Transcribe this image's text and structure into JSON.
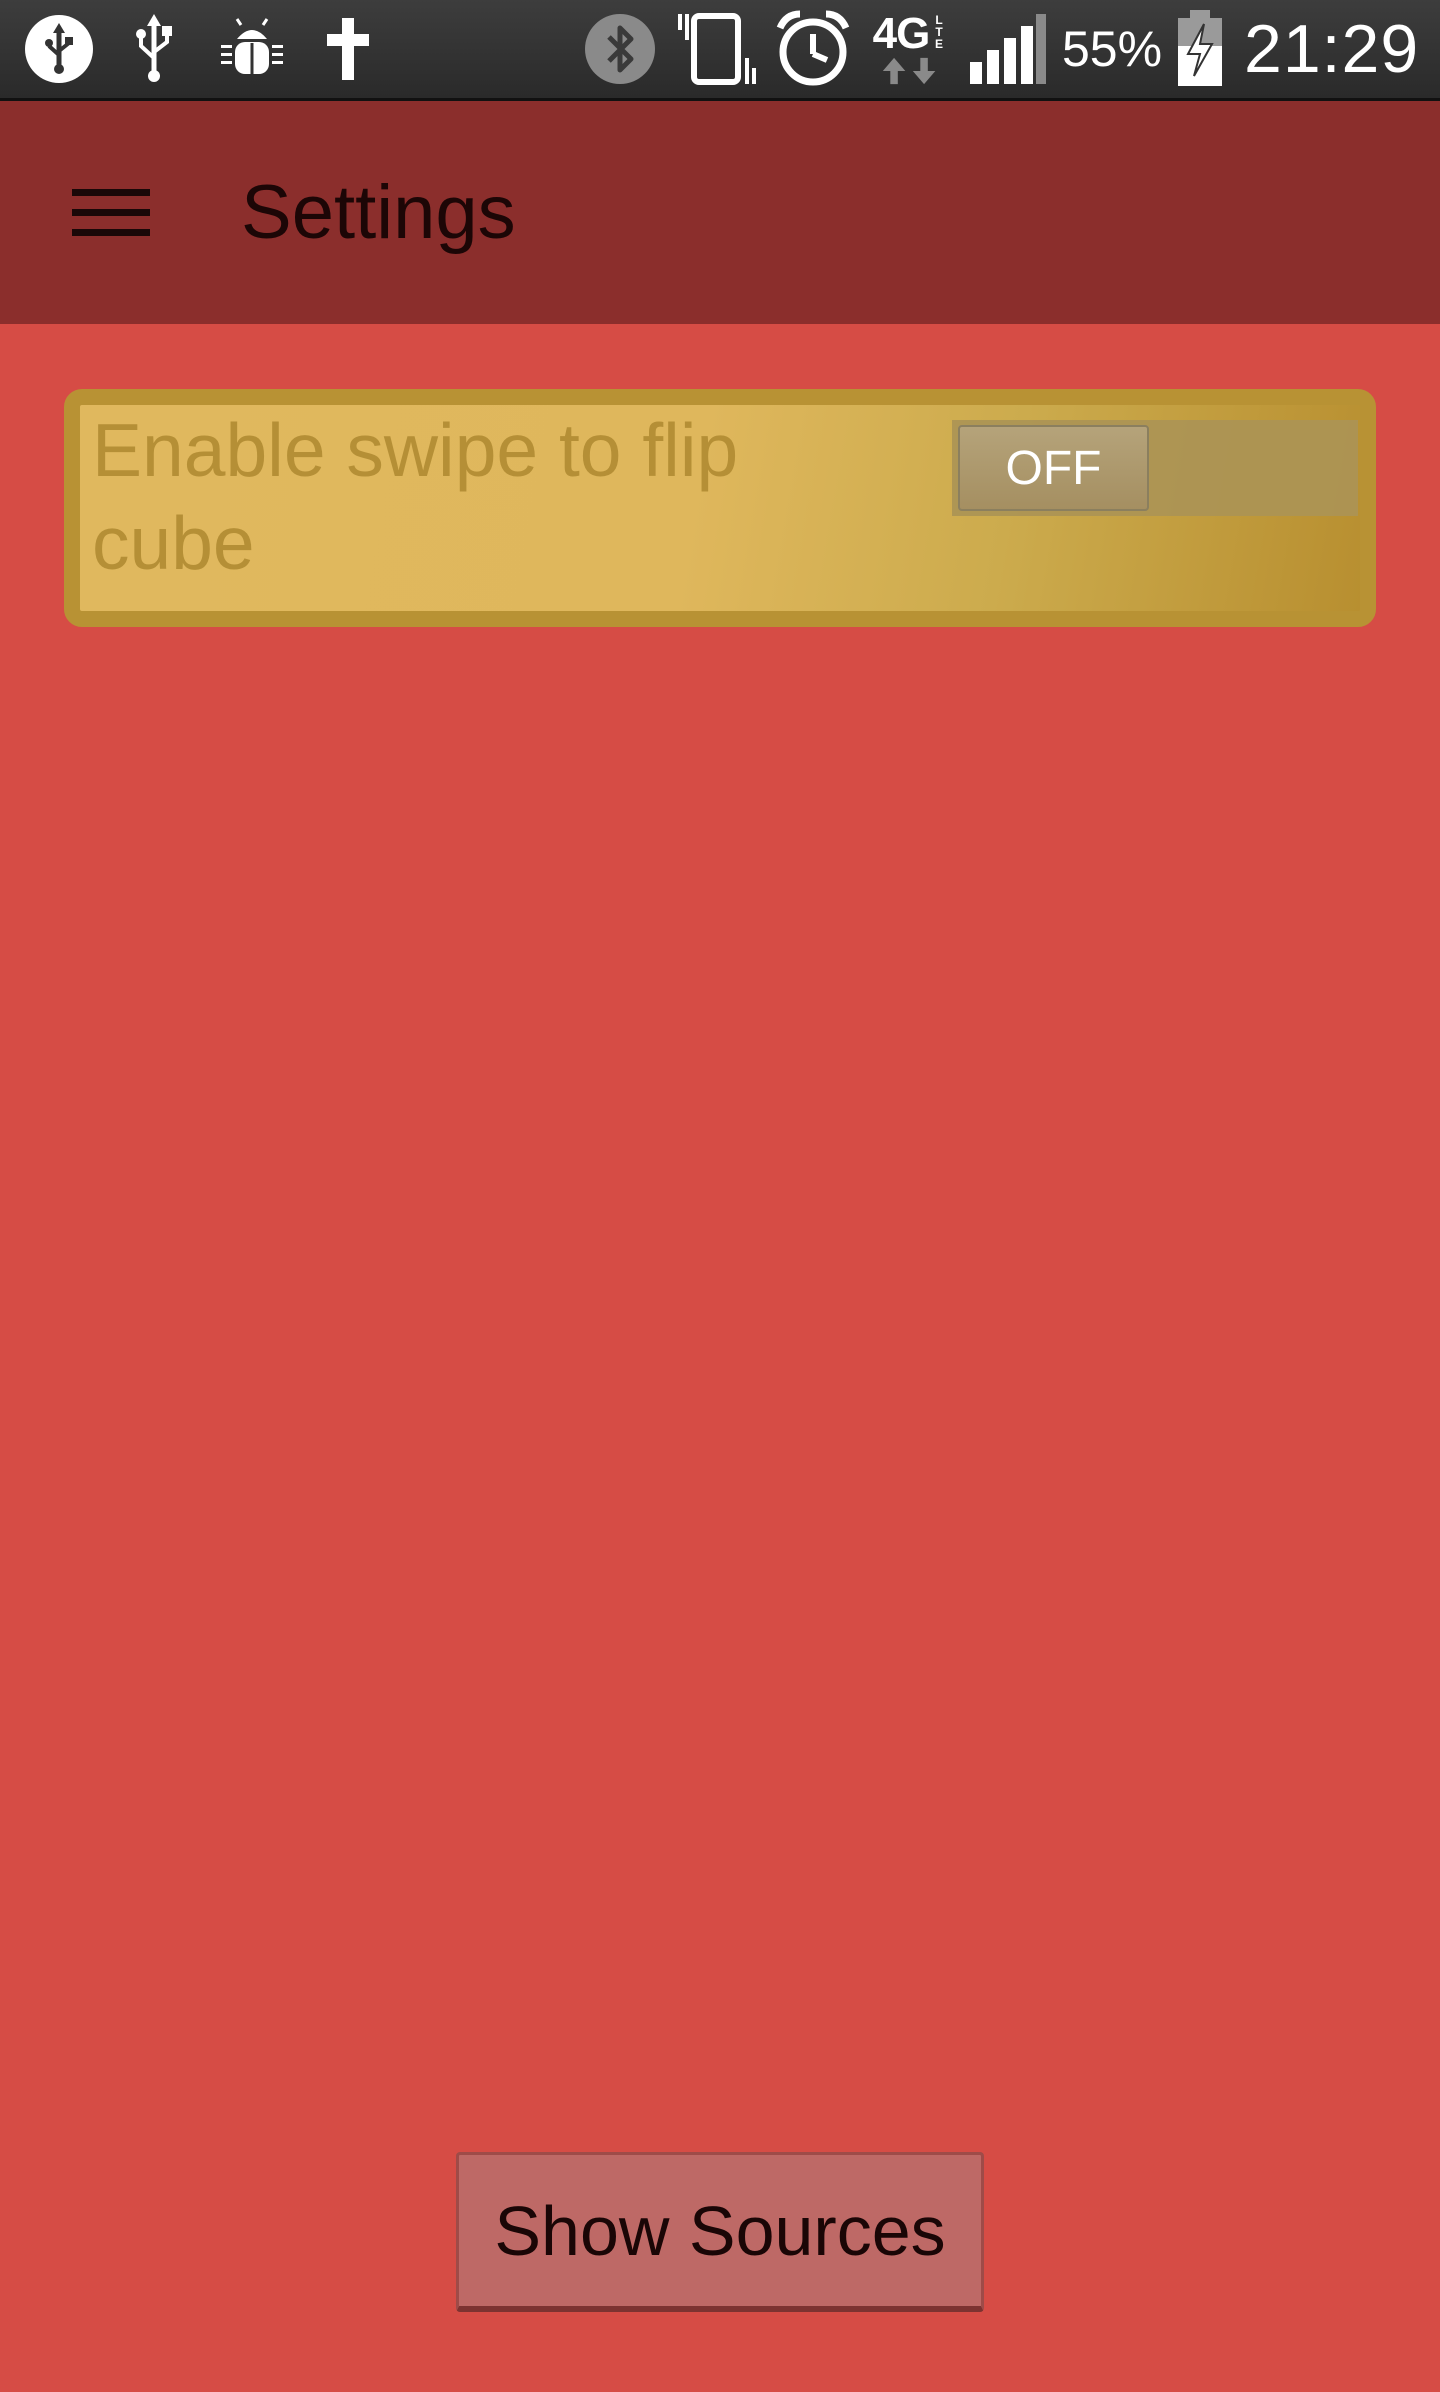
{
  "status_bar": {
    "icons": [
      "usb-debug-icon",
      "usb-icon",
      "android-debug-icon",
      "cross-icon",
      "bluetooth-icon",
      "vibrate-icon",
      "alarm-icon",
      "4g-lte-icon",
      "signal-icon",
      "battery-charging-icon"
    ],
    "network_label": "4G",
    "battery_percent": "55%",
    "time": "21:29"
  },
  "toolbar": {
    "menu_icon": "hamburger-menu-icon",
    "title": "Settings"
  },
  "settings": {
    "swipe_label": "Enable swipe to flip cube",
    "swipe_toggle_state": "OFF"
  },
  "actions": {
    "show_sources_label": "Show Sources"
  },
  "colors": {
    "background": "#d64c45",
    "toolbar": "#8b2e2c",
    "card": "#dfb75c",
    "card_border": "#b89234",
    "button": "#be6966"
  }
}
